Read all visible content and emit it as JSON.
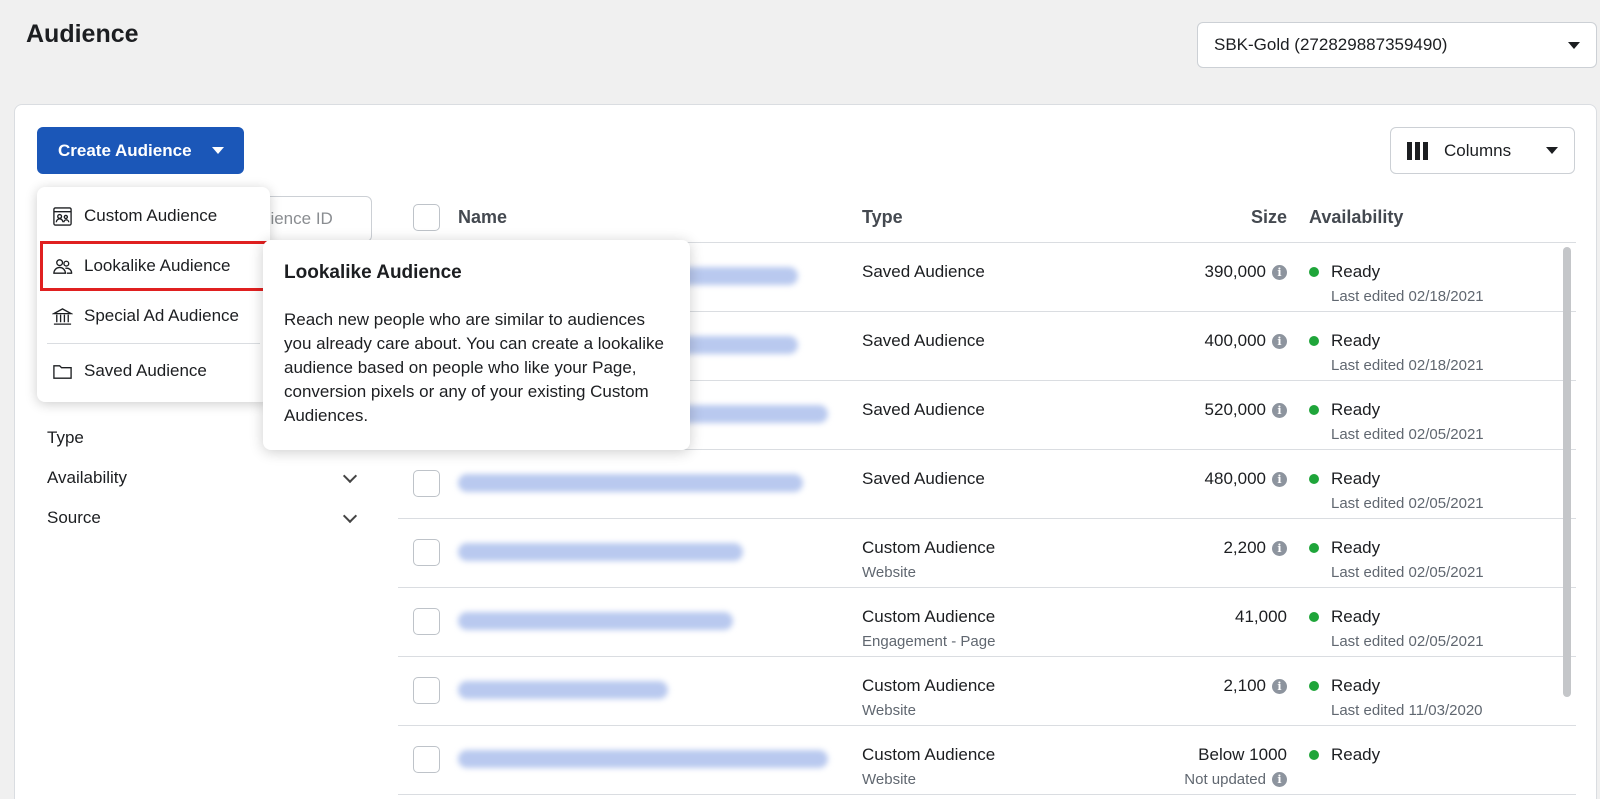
{
  "page": {
    "title": "Audience"
  },
  "account": {
    "label": "SBK-Gold (272829887359490)"
  },
  "toolbar": {
    "create_label": "Create Audience",
    "columns_label": "Columns"
  },
  "search": {
    "placeholder": "dience ID"
  },
  "menu": {
    "items": [
      {
        "label": "Custom Audience",
        "icon": "custom-audience-icon"
      },
      {
        "label": "Lookalike Audience",
        "icon": "lookalike-icon",
        "highlighted": true
      },
      {
        "label": "Special Ad Audience",
        "icon": "bank-icon"
      },
      {
        "label": "Saved Audience",
        "icon": "folder-icon"
      }
    ]
  },
  "tooltip": {
    "title": "Lookalike Audience",
    "body": "Reach new people who are similar to audiences you already care about. You can create a lookalike audience based on people who like your Page, conversion pixels or any of your existing Custom Audiences."
  },
  "filters": [
    {
      "label": "Type"
    },
    {
      "label": "Availability"
    },
    {
      "label": "Source"
    }
  ],
  "table": {
    "headers": {
      "name": "Name",
      "type": "Type",
      "size": "Size",
      "availability": "Availability"
    },
    "rows": [
      {
        "type": "Saved Audience",
        "subtype": "",
        "size": "390,000",
        "size_sub": "",
        "status": "Ready",
        "edited": "Last edited 02/18/2021"
      },
      {
        "type": "Saved Audience",
        "subtype": "",
        "size": "400,000",
        "size_sub": "",
        "status": "Ready",
        "edited": "Last edited 02/18/2021"
      },
      {
        "type": "Saved Audience",
        "subtype": "",
        "size": "520,000",
        "size_sub": "",
        "status": "Ready",
        "edited": "Last edited 02/05/2021"
      },
      {
        "type": "Saved Audience",
        "subtype": "",
        "size": "480,000",
        "size_sub": "",
        "status": "Ready",
        "edited": "Last edited 02/05/2021"
      },
      {
        "type": "Custom Audience",
        "subtype": "Website",
        "size": "2,200",
        "size_sub": "",
        "status": "Ready",
        "edited": "Last edited 02/05/2021"
      },
      {
        "type": "Custom Audience",
        "subtype": "Engagement - Page",
        "size": "41,000",
        "size_sub": "",
        "status": "Ready",
        "edited": "Last edited 02/05/2021"
      },
      {
        "type": "Custom Audience",
        "subtype": "Website",
        "size": "2,100",
        "size_sub": "",
        "status": "Ready",
        "edited": "Last edited 11/03/2020"
      },
      {
        "type": "Custom Audience",
        "subtype": "Website",
        "size": "Below 1000",
        "size_sub": "Not updated",
        "status": "Ready",
        "edited": ""
      }
    ]
  }
}
